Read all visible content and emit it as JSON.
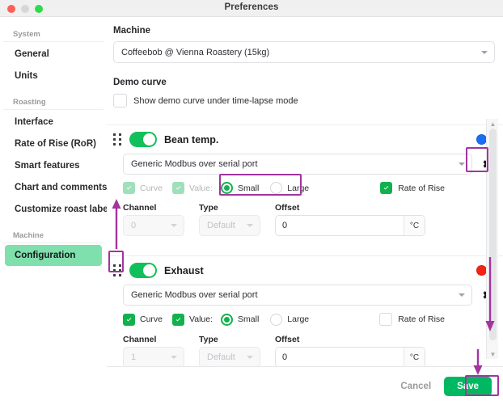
{
  "window": {
    "title": "Preferences",
    "traffic_lights": [
      "close",
      "minimize",
      "zoom"
    ]
  },
  "sidebar": {
    "groups": [
      {
        "label": "System",
        "items": [
          {
            "label": "General",
            "active": false
          },
          {
            "label": "Units",
            "active": false
          }
        ]
      },
      {
        "label": "Roasting",
        "items": [
          {
            "label": "Interface",
            "active": false
          },
          {
            "label": "Rate of Rise (RoR)",
            "active": false
          },
          {
            "label": "Smart features",
            "active": false
          },
          {
            "label": "Chart and comments",
            "active": false
          },
          {
            "label": "Customize roast labels",
            "active": false
          }
        ]
      },
      {
        "label": "Machine",
        "items": [
          {
            "label": "Configuration",
            "active": true
          }
        ]
      }
    ]
  },
  "main": {
    "machine": {
      "label": "Machine",
      "selected": "Coffeebob @ Vienna Roastery (15kg)"
    },
    "demo_curve": {
      "label": "Demo curve",
      "checkbox_label": "Show demo curve under time-lapse mode",
      "checked": false
    },
    "devices": [
      {
        "name": "Bean temp.",
        "enabled": true,
        "status_color": "#1b6ef3",
        "protocol": "Generic Modbus over serial port",
        "curve": {
          "label": "Curve",
          "checked": true,
          "disabled": true
        },
        "value": {
          "label": "Value:",
          "checked": true,
          "disabled": true
        },
        "size": {
          "options": [
            "Small",
            "Large"
          ],
          "selected": "Small"
        },
        "rate_of_rise": {
          "label": "Rate of Rise",
          "checked": true,
          "disabled": false
        },
        "channel": {
          "label": "Channel",
          "value": "0",
          "disabled": true
        },
        "type": {
          "label": "Type",
          "value": "Default",
          "disabled": true
        },
        "offset": {
          "label": "Offset",
          "value": "0",
          "unit": "°C"
        }
      },
      {
        "name": "Exhaust",
        "enabled": true,
        "status_color": "#f32414",
        "protocol": "Generic Modbus over serial port",
        "curve": {
          "label": "Curve",
          "checked": true,
          "disabled": false
        },
        "value": {
          "label": "Value:",
          "checked": true,
          "disabled": false
        },
        "size": {
          "options": [
            "Small",
            "Large"
          ],
          "selected": "Small"
        },
        "rate_of_rise": {
          "label": "Rate of Rise",
          "checked": false,
          "disabled": false
        },
        "channel": {
          "label": "Channel",
          "value": "1",
          "disabled": true
        },
        "type": {
          "label": "Type",
          "value": "Default",
          "disabled": true
        },
        "offset": {
          "label": "Offset",
          "value": "0",
          "unit": "°C"
        }
      }
    ]
  },
  "footer": {
    "cancel_label": "Cancel",
    "save_label": "Save"
  },
  "annotations": {
    "color": "#a3349e",
    "highlight_boxes": [
      "bean-size-radio-group",
      "bean-gear-button",
      "exhaust-drag-handle"
    ],
    "arrows": [
      "up-to-exhaust-handle",
      "down-scrollbar",
      "down-to-save"
    ]
  },
  "icons": {
    "gear": "gear-icon",
    "drag": "drag-handle-icon",
    "caret": "chevron-down-icon",
    "check": "check-icon"
  }
}
